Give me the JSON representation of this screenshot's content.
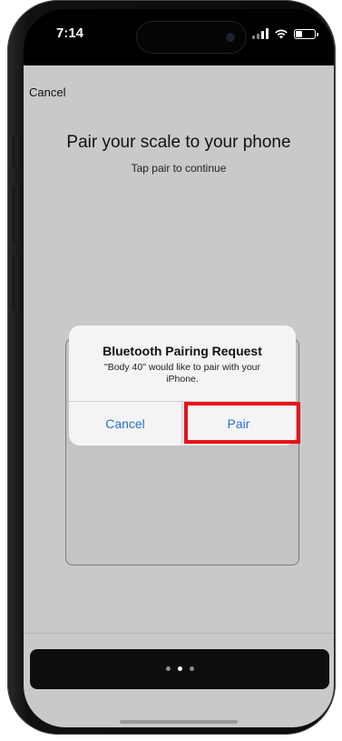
{
  "status_bar": {
    "time": "7:14",
    "icons": [
      "cellular-signal-icon",
      "wifi-icon",
      "battery-icon"
    ]
  },
  "header": {
    "cancel_label": "Cancel"
  },
  "main": {
    "title": "Pair your scale to your phone",
    "subtitle": "Tap pair to continue"
  },
  "alert": {
    "title": "Bluetooth Pairing Request",
    "message": "\"Body 40\" would like to pair with your iPhone.",
    "cancel_label": "Cancel",
    "pair_label": "Pair"
  },
  "pager": {
    "page_count": 3,
    "active_index": 1
  },
  "colors": {
    "app_background": "#c9c9c9",
    "alert_background": "#f4f4f4",
    "alert_button_text": "#2d6fd6",
    "highlight": "#e8121a"
  }
}
